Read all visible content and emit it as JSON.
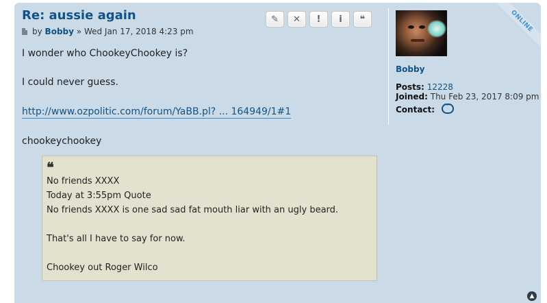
{
  "post": {
    "title": "Re: aussie again",
    "by_label": "by",
    "author": "Bobby",
    "date_text": "» Wed Jan 17, 2018 4:23 pm",
    "online_badge": "ONLINE",
    "actions": [
      {
        "name": "edit-button",
        "icon": "pencil-icon",
        "glyph": "✎"
      },
      {
        "name": "delete-button",
        "icon": "close-icon",
        "glyph": "✕"
      },
      {
        "name": "report-button",
        "icon": "exclamation-icon",
        "glyph": "!"
      },
      {
        "name": "info-button",
        "icon": "info-icon",
        "glyph": "i"
      },
      {
        "name": "quote-button",
        "icon": "quote-icon",
        "glyph": "❝"
      }
    ],
    "body": {
      "p1": "I wonder who ChookeyChookey is?",
      "p2": "I could never guess.",
      "link_text": "http://www.ozpolitic.com/forum/YaBB.pl? ... 164949/1#1",
      "p4": "chookeychookey"
    },
    "quote": {
      "icon_glyph": "❝",
      "lines": [
        "No friends XXXX",
        "Today at 3:55pm Quote",
        "No friends XXXX is one sad sad fat mouth liar with an ugly beard.",
        "",
        "That's all I have to say for now.",
        "",
        "Chookey out Roger Wilco"
      ]
    }
  },
  "profile": {
    "username": "Bobby",
    "posts_label": "Posts:",
    "posts_value": "12228",
    "joined_label": "Joined:",
    "joined_value": "Thu Feb 23, 2017 8:09 pm",
    "contact_label": "Contact:"
  },
  "colors": {
    "post_bg": "#cbdae7",
    "link": "#105289",
    "quote_bg": "#e2e2cf"
  }
}
